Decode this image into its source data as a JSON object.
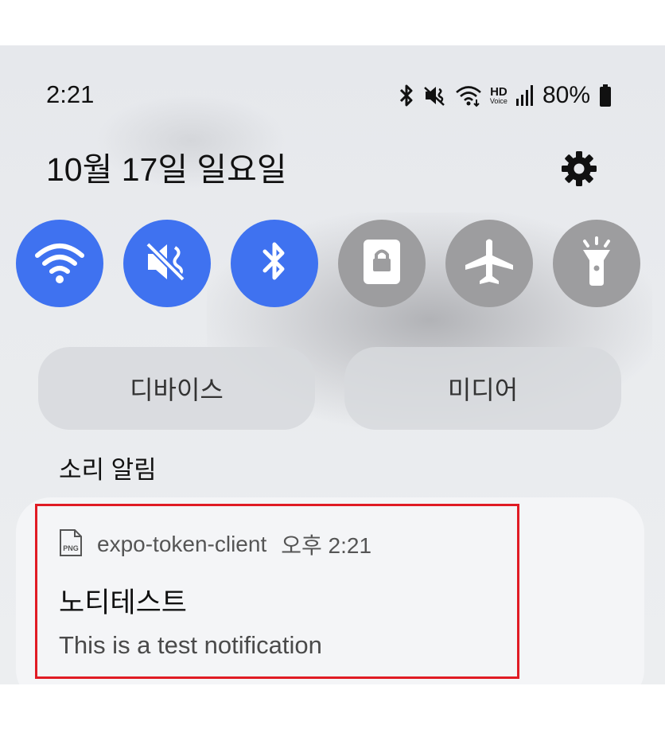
{
  "status_bar": {
    "time": "2:21",
    "icons": [
      "bluetooth-icon",
      "vibrate-mute-icon",
      "wifi-icon",
      "hd-voice-icon",
      "signal-icon",
      "battery-icon"
    ],
    "hd_label": "HD",
    "voice_label": "Voice",
    "battery": "80%"
  },
  "header": {
    "date": "10월 17일 일요일",
    "settings_icon": "gear-icon"
  },
  "quick_toggles": [
    {
      "name": "wifi",
      "icon": "wifi-icon",
      "on": true
    },
    {
      "name": "mute",
      "icon": "mute-icon",
      "on": true
    },
    {
      "name": "bluetooth",
      "icon": "bluetooth-icon",
      "on": true
    },
    {
      "name": "lock",
      "icon": "lock-icon",
      "on": false
    },
    {
      "name": "airplane",
      "icon": "airplane-icon",
      "on": false
    },
    {
      "name": "flashlight",
      "icon": "flashlight-icon",
      "on": false
    }
  ],
  "pills": {
    "devices": "디바이스",
    "media": "미디어"
  },
  "section": {
    "title": "소리 알림"
  },
  "notification": {
    "app_icon": "png-file-icon",
    "app_icon_text": "PNG",
    "app_name": "expo-token-client",
    "time": "오후 2:21",
    "title": "노티테스트",
    "body": "This is a test notification"
  },
  "colors": {
    "toggle_on": "#3f72f0",
    "toggle_off": "#9d9d9f",
    "highlight": "#e01b24"
  }
}
